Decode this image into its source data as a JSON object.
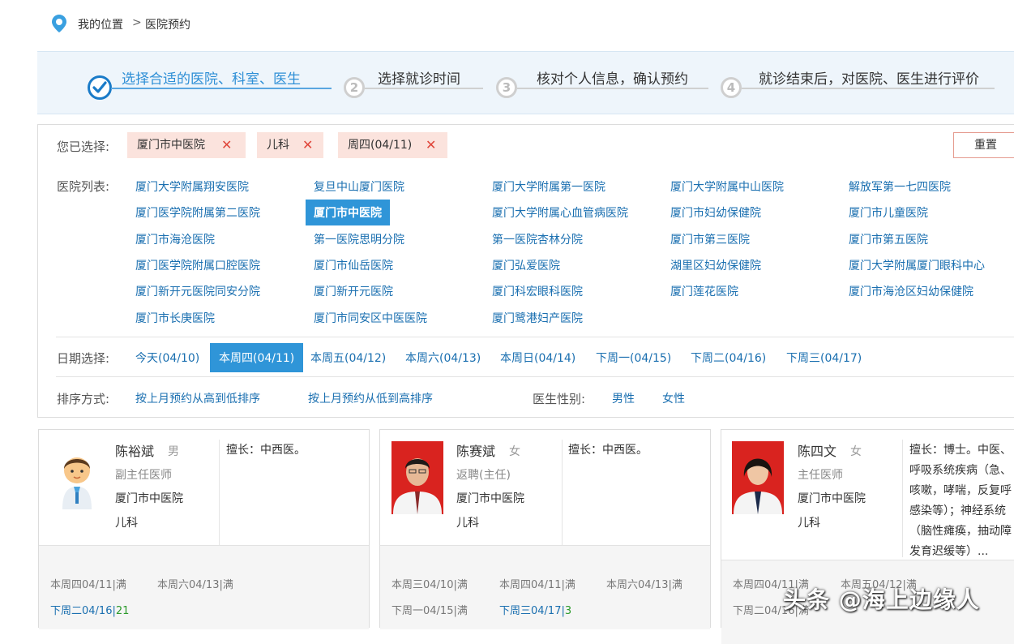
{
  "breadcrumb": {
    "my_location": "我的位置",
    "separator": ">",
    "current": "医院预约"
  },
  "steps": [
    {
      "num": "",
      "label": "选择合适的医院、科室、医生",
      "active": true
    },
    {
      "num": "2",
      "label": "选择就诊时间",
      "active": false
    },
    {
      "num": "3",
      "label": "核对个人信息，确认预约",
      "active": false
    },
    {
      "num": "4",
      "label": "就诊结束后，对医院、医生进行评价",
      "active": false
    }
  ],
  "selected": {
    "label": "您已选择:",
    "tags": [
      "厦门市中医院",
      "儿科",
      "周四(04/11)"
    ],
    "remove_glyph": "✕",
    "reset": "重置"
  },
  "hospitals": {
    "label": "医院列表:",
    "selected": "厦门市中医院",
    "items": [
      "厦门大学附属翔安医院",
      "复旦中山厦门医院",
      "厦门大学附属第一医院",
      "厦门大学附属中山医院",
      "解放军第一七四医院",
      "厦门医学院附属第二医院",
      "厦门市中医院",
      "厦门大学附属心血管病医院",
      "厦门市妇幼保健院",
      "厦门市儿童医院",
      "厦门市海沧医院",
      "第一医院思明分院",
      "第一医院杏林分院",
      "厦门市第三医院",
      "厦门市第五医院",
      "厦门医学院附属口腔医院",
      "厦门市仙岳医院",
      "厦门弘爱医院",
      "湖里区妇幼保健院",
      "厦门大学附属厦门眼科中心",
      "厦门新开元医院同安分院",
      "厦门新开元医院",
      "厦门科宏眼科医院",
      "厦门莲花医院",
      "厦门市海沧区妇幼保健院",
      "厦门市长庚医院",
      "厦门市同安区中医医院",
      "厦门鹭港妇产医院"
    ]
  },
  "dates": {
    "label": "日期选择:",
    "items": [
      "今天(04/10)",
      "本周四(04/11)",
      "本周五(04/12)",
      "本周六(04/13)",
      "本周日(04/14)",
      "下周一(04/15)",
      "下周二(04/16)",
      "下周三(04/17)"
    ],
    "selected_index": 1
  },
  "sort": {
    "label": "排序方式:",
    "high_to_low": "按上月预约从高到低排序",
    "low_to_high": "按上月预约从低到高排序",
    "gender_label": "医生性别:",
    "male": "男性",
    "female": "女性"
  },
  "doctors": [
    {
      "name": "陈裕斌",
      "sex": "男",
      "title": "副主任医师",
      "hospital": "厦门市中医院",
      "dept": "儿科",
      "specialty": "擅长：中西医。",
      "slots": [
        {
          "text": "本周四04/11|满",
          "available": false
        },
        {
          "text": "本周六04/13|满",
          "available": false
        },
        {
          "text": "下周二04/16|",
          "count": "21",
          "available": true
        }
      ]
    },
    {
      "name": "陈赛斌",
      "sex": "女",
      "title": "返聘(主任)",
      "hospital": "厦门市中医院",
      "dept": "儿科",
      "specialty": "擅长：中西医。",
      "slots": [
        {
          "text": "本周三04/10|满",
          "available": false
        },
        {
          "text": "本周四04/11|满",
          "available": false
        },
        {
          "text": "本周六04/13|满",
          "available": false
        },
        {
          "text": "下周一04/15|满",
          "available": false
        },
        {
          "text": "下周三04/17|",
          "count": "3",
          "available": true
        }
      ]
    },
    {
      "name": "陈四文",
      "sex": "女",
      "title": "主任医师",
      "hospital": "厦门市中医院",
      "dept": "儿科",
      "specialty_lines": [
        "擅长：博士。中医、",
        "呼吸系统疾病（急、",
        "咳嗽，哮喘，反复呼",
        "感染等）；神经系统",
        "（脑性瘫痪，抽动障",
        "发育迟缓等）..."
      ],
      "slots": [
        {
          "text": "本周四04/11|满",
          "available": false
        },
        {
          "text": "本周五04/12|满",
          "available": false
        },
        {
          "text": "下周二04/16|满",
          "available": false
        }
      ]
    }
  ],
  "watermark": "头条 @海上边缘人",
  "colors": {
    "accent": "#2f95d8",
    "link": "#1a6fb0",
    "tag_bg": "#fbe3dd",
    "remove": "#e0463a",
    "available_count": "#2a9a2a"
  }
}
